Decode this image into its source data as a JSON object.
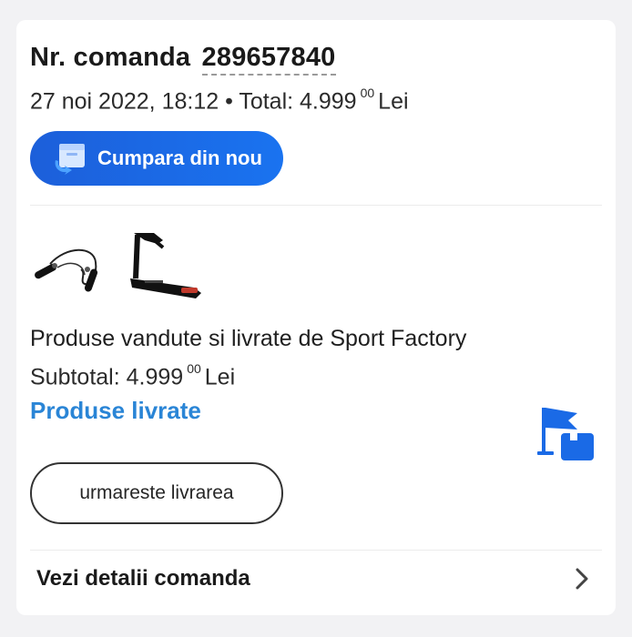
{
  "order": {
    "title_prefix": "Nr. comanda",
    "number": "289657840",
    "date": "27 noi 2022, 18:12 • Total: 4.999",
    "total_decimals": "00",
    "currency": "Lei"
  },
  "reorder": {
    "label": "Cumpara din nou",
    "icon": "reorder-box-icon"
  },
  "products": [
    {
      "name": "jump-rope",
      "icon": "jump-rope-image"
    },
    {
      "name": "treadmill",
      "icon": "treadmill-image"
    }
  ],
  "seller": {
    "label": "Produse vandute si livrate de Sport Factory"
  },
  "subtotal": {
    "label": "Subtotal: 4.999",
    "decimals": "00",
    "currency": "Lei"
  },
  "status": {
    "label": "Produse livrate",
    "color": "#2a85d6",
    "icon": "delivered-flag-icon"
  },
  "track": {
    "label": "urmareste livrarea"
  },
  "details": {
    "label": "Vezi detalii comanda",
    "icon": "chevron-right-icon"
  },
  "colors": {
    "accent": "#1a6ae6",
    "status": "#2a85d6"
  }
}
